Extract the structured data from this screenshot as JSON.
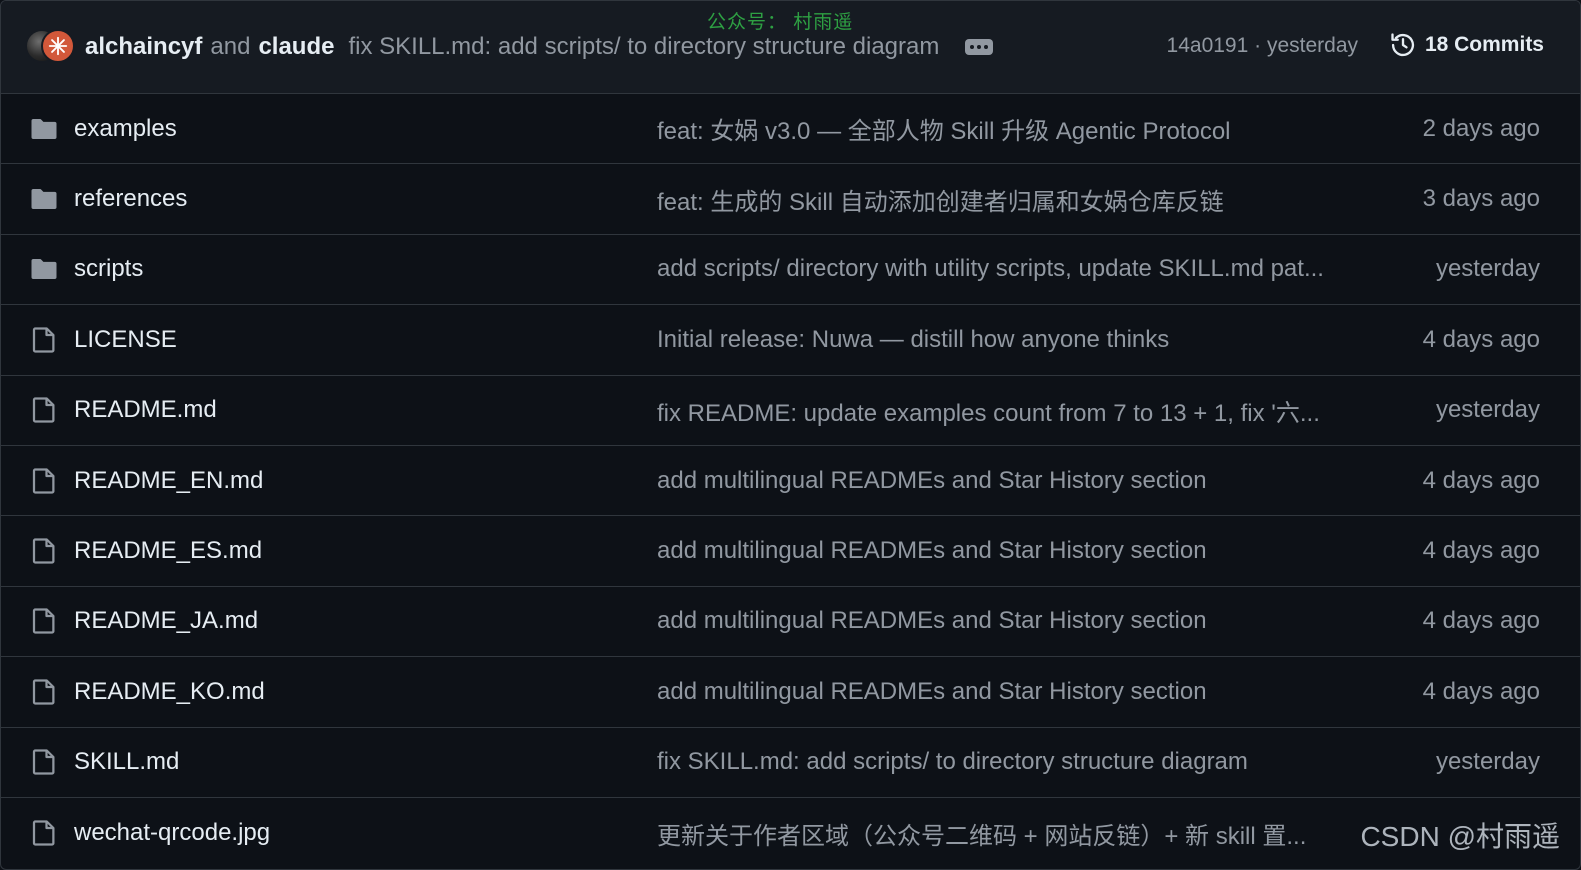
{
  "watermark_top": "公众号： 村雨遥",
  "header": {
    "author_1": "alchaincyf",
    "and_text": "and",
    "author_2": "claude",
    "commit_message": "fix SKILL.md: add scripts/ to directory structure diagram",
    "sha_time": "14a0191 · yesterday",
    "commits_label": "18 Commits"
  },
  "files": [
    {
      "type": "folder",
      "name": "examples",
      "message": "feat: 女娲 v3.0 — 全部人物 Skill 升级 Agentic Protocol",
      "age": "2 days ago"
    },
    {
      "type": "folder",
      "name": "references",
      "message": "feat: 生成的 Skill 自动添加创建者归属和女娲仓库反链",
      "age": "3 days ago"
    },
    {
      "type": "folder",
      "name": "scripts",
      "message": "add scripts/ directory with utility scripts, update SKILL.md pat...",
      "age": "yesterday"
    },
    {
      "type": "file",
      "name": "LICENSE",
      "message": "Initial release: Nuwa — distill how anyone thinks",
      "age": "4 days ago"
    },
    {
      "type": "file",
      "name": "README.md",
      "message": "fix README: update examples count from 7 to 13 + 1, fix '六...",
      "age": "yesterday"
    },
    {
      "type": "file",
      "name": "README_EN.md",
      "message": "add multilingual READMEs and Star History section",
      "age": "4 days ago"
    },
    {
      "type": "file",
      "name": "README_ES.md",
      "message": "add multilingual READMEs and Star History section",
      "age": "4 days ago"
    },
    {
      "type": "file",
      "name": "README_JA.md",
      "message": "add multilingual READMEs and Star History section",
      "age": "4 days ago"
    },
    {
      "type": "file",
      "name": "README_KO.md",
      "message": "add multilingual READMEs and Star History section",
      "age": "4 days ago"
    },
    {
      "type": "file",
      "name": "SKILL.md",
      "message": "fix SKILL.md: add scripts/ to directory structure diagram",
      "age": "yesterday"
    },
    {
      "type": "file",
      "name": "wechat-qrcode.jpg",
      "message": "更新关于作者区域（公众号二维码 + 网站反链）+ 新 skill 置...",
      "age": ""
    }
  ],
  "watermark_bottom": "CSDN @村雨遥",
  "colors": {
    "background": "#0d1117",
    "header_bg": "#161b22",
    "border": "#30363d",
    "text_primary": "#e6edf3",
    "text_muted": "#9198a1",
    "watermark_green": "#2ea043"
  },
  "icons": {
    "folder": "folder-icon",
    "file": "file-icon",
    "history": "history-icon",
    "ellipsis": "ellipsis-icon"
  }
}
